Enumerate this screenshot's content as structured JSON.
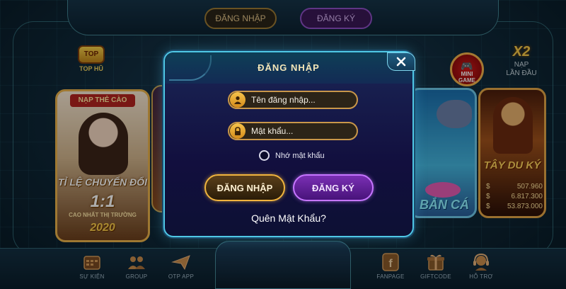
{
  "header": {
    "login_label": "ĐĂNG NHẬP",
    "register_label": "ĐĂNG KÝ"
  },
  "side": {
    "top_hu_label": "TOP HŨ",
    "top_hu_icon": "TOP",
    "mini_game_label": "MINI GAME",
    "x2_label": "X2",
    "nap_lan_dau_line1": "NẠP",
    "nap_lan_dau_line2": "LẦN ĐẦU"
  },
  "cards": {
    "left": {
      "title": "NẠP THẺ CÀO",
      "ratio_label": "TỈ LỆ CHUYỂN ĐỔI",
      "ratio": "1:1",
      "promo": "CAO NHẤT THỊ TRƯỜNG",
      "year": "2020"
    },
    "fish_text": "BẮN CÁ",
    "right": {
      "name": "TÂY DU KÝ",
      "jackpots": [
        {
          "currency": "$",
          "value": "507.960"
        },
        {
          "currency": "$",
          "value": "6.817.300"
        },
        {
          "currency": "$",
          "value": "53.873.000"
        }
      ]
    }
  },
  "modal": {
    "title": "ĐĂNG NHẬP",
    "username_placeholder": "Tên đăng nhập...",
    "password_placeholder": "Mật khẩu...",
    "remember_label": "Nhớ mật khẩu",
    "login_button": "ĐĂNG NHẬP",
    "register_button": "ĐĂNG KÝ",
    "forgot_link": "Quên Mật Khẩu?"
  },
  "bottom_nav": {
    "su_kien": "SỰ KIỆN",
    "group": "GROUP",
    "otp_app": "OTP APP",
    "fanpage": "FANPAGE",
    "giftcode": "GIFTCODE",
    "ho_tro": "HỖ TRỢ"
  },
  "icons": {
    "user": "user-icon",
    "lock": "lock-icon",
    "close": "close-icon",
    "calendar": "calendar-icon",
    "group": "group-icon",
    "paper_plane": "paper-plane-icon",
    "facebook": "facebook-icon",
    "gift": "gift-icon",
    "support": "support-icon",
    "gamepad": "gamepad-icon"
  },
  "colors": {
    "gold_border": "#c9974a",
    "modal_border": "#4fc8e6",
    "purple_button": "#7a2fb4"
  }
}
